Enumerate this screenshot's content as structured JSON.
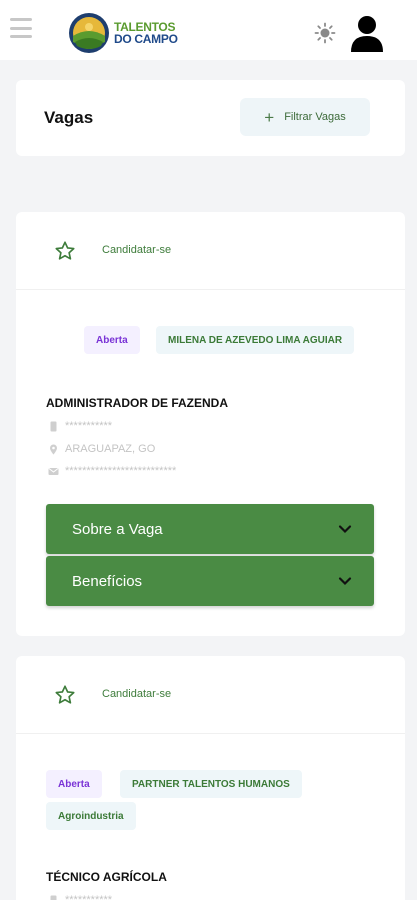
{
  "app": {
    "logo_line1": "TALENTOS",
    "logo_line2": "DO CAMPO",
    "icons": {
      "menu": "hamburger-icon",
      "theme": "sun-icon",
      "account": "user-icon"
    }
  },
  "header": {
    "title": "Vagas",
    "filter_label": "Filtrar Vagas",
    "filter_icon": "plus-icon"
  },
  "jobs": [
    {
      "apply_label": "Candidatar-se",
      "status": "Aberta",
      "company": "MILENA DE AZEVEDO LIMA AGUIAR",
      "title": "ADMINISTRADOR DE FAZENDA",
      "phone": "***********",
      "location": "ARAGUAPAZ, GO",
      "email": "**************************",
      "sections": [
        "Sobre a Vaga",
        "Benefícios"
      ]
    },
    {
      "apply_label": "Candidatar-se",
      "status": "Aberta",
      "company": "PARTNER TALENTOS HUMANOS",
      "sector": "Agroindustria",
      "title": "TÉCNICO AGRÍCOLA",
      "phone": "***********"
    }
  ],
  "colors": {
    "brand_green": "#4a8b44",
    "status_purple": "#7a33d6",
    "chip_bg": "#eef6f9"
  }
}
